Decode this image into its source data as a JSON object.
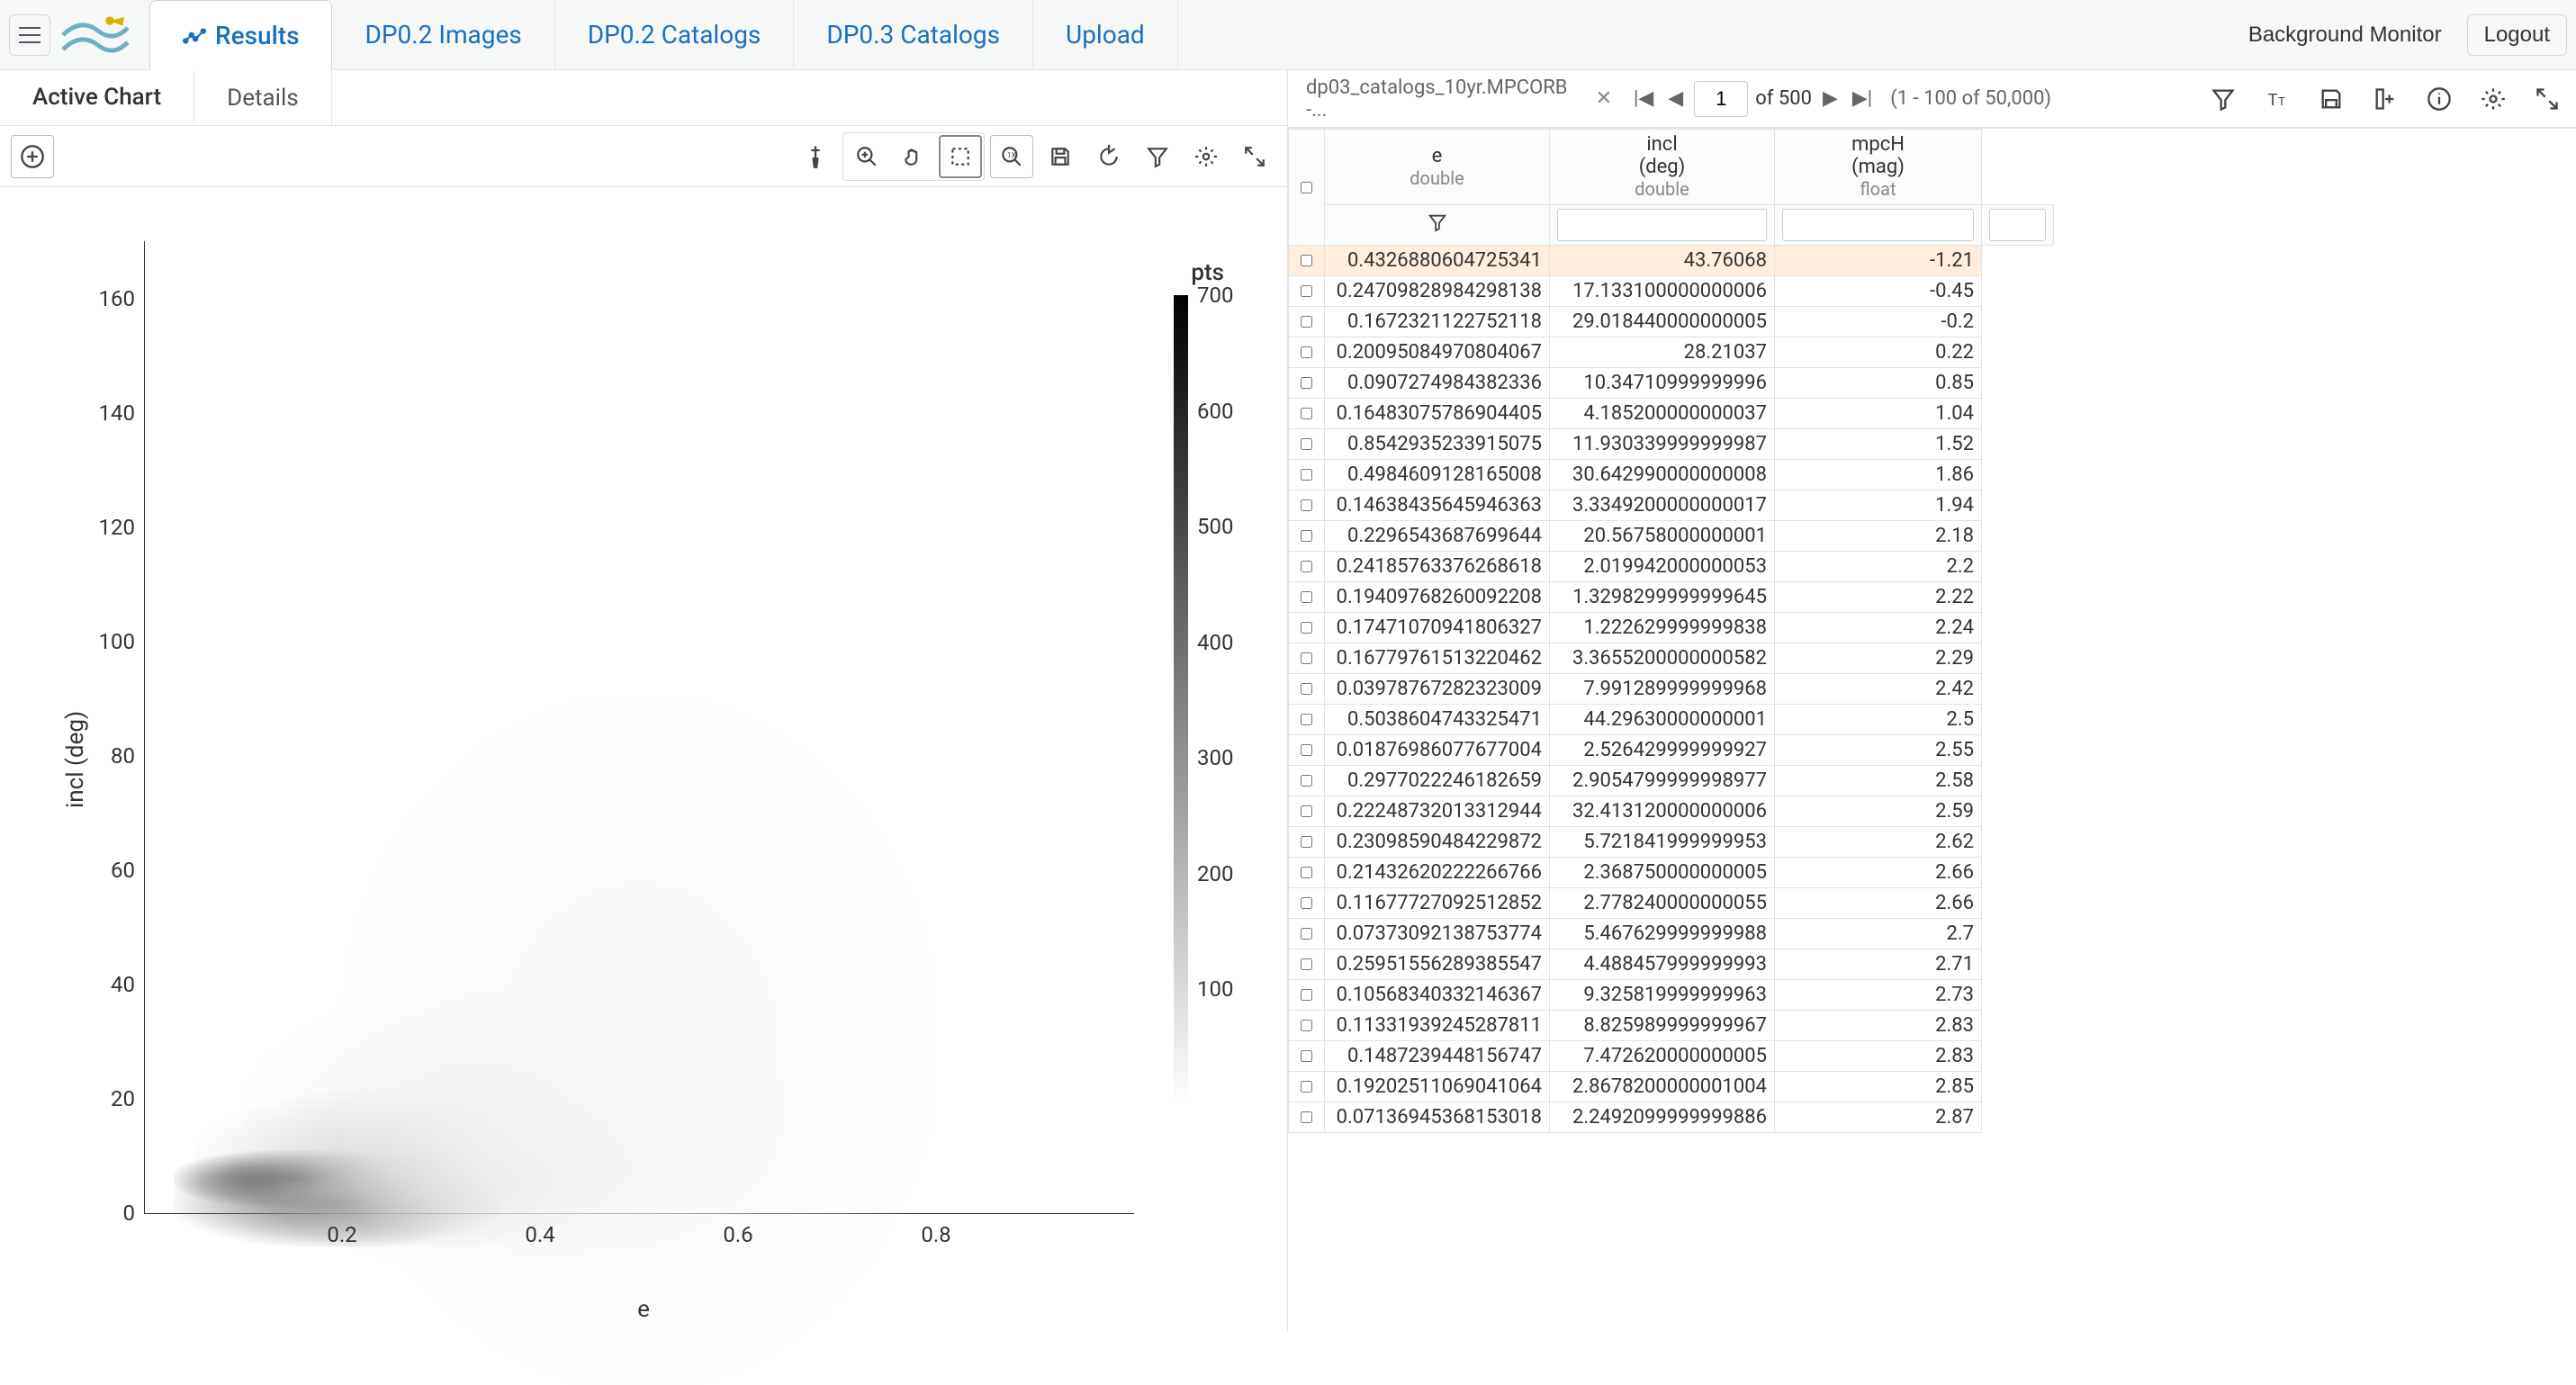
{
  "topbar": {
    "nav": [
      {
        "label": "Results",
        "active": true
      },
      {
        "label": "DP0.2 Images"
      },
      {
        "label": "DP0.2 Catalogs"
      },
      {
        "label": "DP0.3 Catalogs"
      },
      {
        "label": "Upload"
      }
    ],
    "background_monitor": "Background Monitor",
    "logout": "Logout"
  },
  "left": {
    "subtabs": [
      {
        "label": "Active Chart",
        "active": true
      },
      {
        "label": "Details"
      }
    ]
  },
  "chart_data": {
    "type": "heatmap",
    "xlabel": "e",
    "ylabel": "incl (deg)",
    "xlim": [
      0,
      1
    ],
    "ylim": [
      0,
      170
    ],
    "x_ticks": [
      0.2,
      0.4,
      0.6,
      0.8
    ],
    "y_ticks": [
      0,
      20,
      40,
      60,
      80,
      100,
      120,
      140,
      160
    ],
    "colorbar": {
      "label": "pts",
      "ticks": [
        100,
        200,
        300,
        400,
        500,
        600,
        700
      ],
      "min": 0,
      "max": 700
    },
    "hotspots": [
      {
        "x": 0.03,
        "y": 6,
        "w": 0.25,
        "h": 10,
        "intensity": 0.95
      },
      {
        "x": 0.03,
        "y": 2,
        "w": 0.33,
        "h": 16,
        "intensity": 0.6
      },
      {
        "x": 0.05,
        "y": 8,
        "w": 0.45,
        "h": 28,
        "intensity": 0.22
      },
      {
        "x": 0.1,
        "y": 15,
        "w": 0.55,
        "h": 50,
        "intensity": 0.08
      },
      {
        "x": 0.2,
        "y": 30,
        "w": 0.6,
        "h": 120,
        "intensity": 0.03
      }
    ]
  },
  "table": {
    "title": "dp03_catalogs_10yr.MPCORB -...",
    "pager": {
      "page": "1",
      "of_label": "of 500"
    },
    "range": "(1 - 100 of 50,000)",
    "columns": [
      {
        "name": "e",
        "type": "double"
      },
      {
        "name": "incl",
        "sub": "(deg)",
        "type": "double"
      },
      {
        "name": "mpcH",
        "sub": "(mag)",
        "type": "float"
      }
    ],
    "rows": [
      {
        "e": "0.4326880604725341",
        "incl": "43.76068",
        "mpcH": "-1.21",
        "highlight": true
      },
      {
        "e": "0.24709828984298138",
        "incl": "17.133100000000006",
        "mpcH": "-0.45"
      },
      {
        "e": "0.1672321122752118",
        "incl": "29.018440000000005",
        "mpcH": "-0.2"
      },
      {
        "e": "0.20095084970804067",
        "incl": "28.21037",
        "mpcH": "0.22"
      },
      {
        "e": "0.0907274984382336",
        "incl": "10.34710999999996",
        "mpcH": "0.85"
      },
      {
        "e": "0.16483075786904405",
        "incl": "4.185200000000037",
        "mpcH": "1.04"
      },
      {
        "e": "0.8542935233915075",
        "incl": "11.930339999999987",
        "mpcH": "1.52"
      },
      {
        "e": "0.4984609128165008",
        "incl": "30.642990000000008",
        "mpcH": "1.86"
      },
      {
        "e": "0.14638435645946363",
        "incl": "3.3349200000000017",
        "mpcH": "1.94"
      },
      {
        "e": "0.2296543687699644",
        "incl": "20.56758000000001",
        "mpcH": "2.18"
      },
      {
        "e": "0.24185763376268618",
        "incl": "2.019942000000053",
        "mpcH": "2.2"
      },
      {
        "e": "0.19409768260092208",
        "incl": "1.3298299999999645",
        "mpcH": "2.22"
      },
      {
        "e": "0.17471070941806327",
        "incl": "1.222629999999838",
        "mpcH": "2.24"
      },
      {
        "e": "0.16779761513220462",
        "incl": "3.3655200000000582",
        "mpcH": "2.29"
      },
      {
        "e": "0.03978767282323009",
        "incl": "7.991289999999968",
        "mpcH": "2.42"
      },
      {
        "e": "0.5038604743325471",
        "incl": "44.29630000000001",
        "mpcH": "2.5"
      },
      {
        "e": "0.01876986077677004",
        "incl": "2.526429999999927",
        "mpcH": "2.55"
      },
      {
        "e": "0.2977022246182659",
        "incl": "2.9054799999998977",
        "mpcH": "2.58"
      },
      {
        "e": "0.22248732013312944",
        "incl": "32.413120000000006",
        "mpcH": "2.59"
      },
      {
        "e": "0.23098590484229872",
        "incl": "5.721841999999953",
        "mpcH": "2.62"
      },
      {
        "e": "0.21432620222266766",
        "incl": "2.368750000000005",
        "mpcH": "2.66"
      },
      {
        "e": "0.11677727092512852",
        "incl": "2.778240000000055",
        "mpcH": "2.66"
      },
      {
        "e": "0.07373092138753774",
        "incl": "5.467629999999988",
        "mpcH": "2.7"
      },
      {
        "e": "0.25951556289385547",
        "incl": "4.488457999999993",
        "mpcH": "2.71"
      },
      {
        "e": "0.10568340332146367",
        "incl": "9.325819999999963",
        "mpcH": "2.73"
      },
      {
        "e": "0.11331939245287811",
        "incl": "8.825989999999967",
        "mpcH": "2.83"
      },
      {
        "e": "0.1487239448156747",
        "incl": "7.472620000000005",
        "mpcH": "2.83"
      },
      {
        "e": "0.19202511069041064",
        "incl": "2.8678200000001004",
        "mpcH": "2.85"
      },
      {
        "e": "0.07136945368153018",
        "incl": "2.2492099999999886",
        "mpcH": "2.87"
      }
    ]
  }
}
